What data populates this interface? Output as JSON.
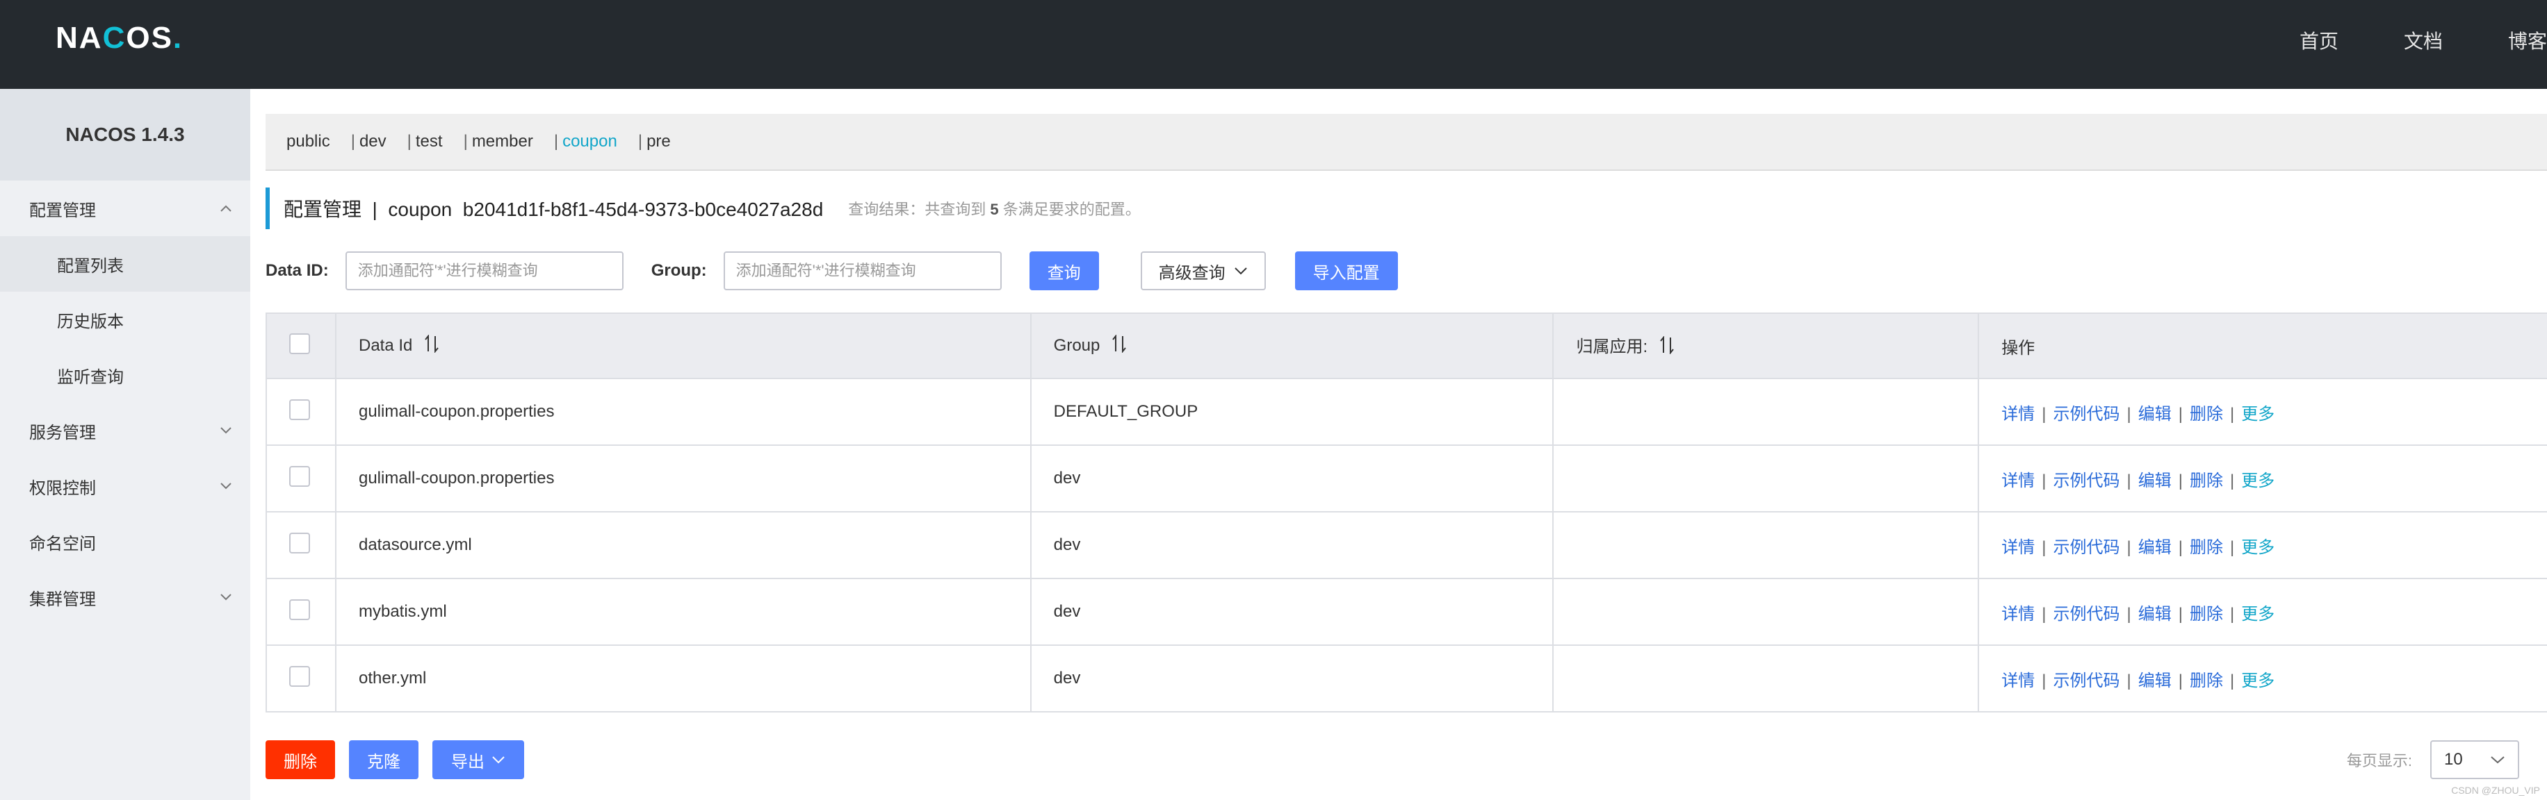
{
  "header": {
    "logo": "NACOS.",
    "nav": [
      "首页",
      "文档",
      "博客"
    ]
  },
  "sidebar": {
    "version": "NACOS 1.4.3",
    "config_group": "配置管理",
    "config_items": [
      "配置列表",
      "历史版本",
      "监听查询"
    ],
    "service_group": "服务管理",
    "auth_group": "权限控制",
    "namespace": "命名空间",
    "cluster_group": "集群管理"
  },
  "namespaces": [
    "public",
    "dev",
    "test",
    "member",
    "coupon",
    "pre"
  ],
  "active_namespace": "coupon",
  "title": {
    "main": "配置管理  |  coupon  b2041d1f-b8f1-45d4-9373-b0ce4027a28d",
    "hint_prefix": "查询结果：共查询到",
    "hint_count": "5",
    "hint_suffix": "条满足要求的配置。"
  },
  "search": {
    "dataid_label": "Data ID:",
    "dataid_placeholder": "添加通配符'*'进行模糊查询",
    "group_label": "Group:",
    "group_placeholder": "添加通配符'*'进行模糊查询",
    "query_btn": "查询",
    "advanced_btn": "高级查询",
    "import_btn": "导入配置"
  },
  "table": {
    "headers": [
      "Data Id",
      "Group",
      "归属应用:",
      "操作"
    ],
    "rows": [
      {
        "data_id": "gulimall-coupon.properties",
        "group": "DEFAULT_GROUP",
        "app": ""
      },
      {
        "data_id": "gulimall-coupon.properties",
        "group": "dev",
        "app": ""
      },
      {
        "data_id": "datasource.yml",
        "group": "dev",
        "app": ""
      },
      {
        "data_id": "mybatis.yml",
        "group": "dev",
        "app": ""
      },
      {
        "data_id": "other.yml",
        "group": "dev",
        "app": ""
      }
    ],
    "ops": [
      "详情",
      "示例代码",
      "编辑",
      "删除",
      "更多"
    ]
  },
  "bottom": {
    "delete_btn": "删除",
    "clone_btn": "克隆",
    "export_btn": "导出",
    "page_size_label": "每页显示:",
    "page_size": "10"
  },
  "watermark": "CSDN @ZHOU_VIP",
  "colors": {
    "accent": "#5584ff",
    "danger": "#ff3000",
    "link": "#2a6bd9",
    "active_ns": "#12a6c9",
    "topbar": "#252a2f"
  }
}
